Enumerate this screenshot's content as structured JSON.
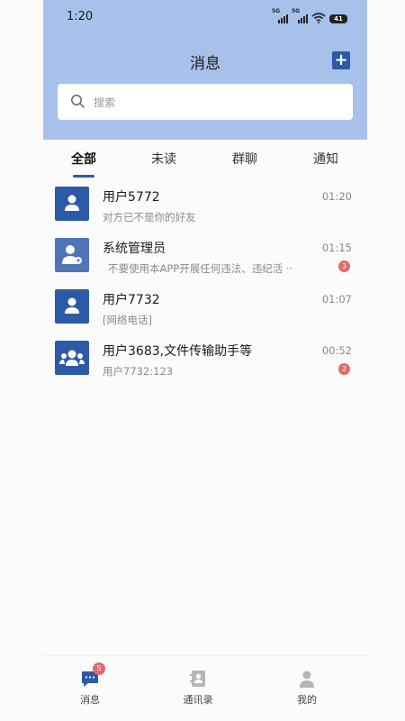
{
  "status_bar": {
    "time": "1:20",
    "network_1": "5G",
    "network_2": "5G",
    "battery": "41"
  },
  "header": {
    "title": "消息",
    "add_label": "+"
  },
  "search": {
    "placeholder": "搜索",
    "value": ""
  },
  "tabs": [
    {
      "label": "全部",
      "active": true
    },
    {
      "label": "未读",
      "active": false
    },
    {
      "label": "群聊",
      "active": false
    },
    {
      "label": "通知",
      "active": false
    }
  ],
  "conversations": [
    {
      "title": "用户5772",
      "preview": "对方已不是你的好友",
      "time": "01:20",
      "avatar": "user-icon",
      "badge": ""
    },
    {
      "title": "系统管理员",
      "preview": "不要使用本APP开展任何违法、违纪活 ··",
      "time": "01:15",
      "avatar": "admin-user-icon",
      "badge": "3"
    },
    {
      "title": "用户7732",
      "preview": "[网络电话]",
      "time": "01:07",
      "avatar": "user-icon",
      "badge": ""
    },
    {
      "title": "用户3683,文件传输助手等",
      "preview": "用户7732:123",
      "time": "00:52",
      "avatar": "group-icon",
      "badge": "2"
    }
  ],
  "bottom_nav": [
    {
      "label": "消息",
      "icon": "chat-icon",
      "badge": "5"
    },
    {
      "label": "通讯录",
      "icon": "contacts-icon"
    },
    {
      "label": "我的",
      "icon": "profile-icon"
    }
  ],
  "colors": {
    "header": "#a8c1ea",
    "accent": "#2d5aa6",
    "badge": "#e06a6a"
  }
}
